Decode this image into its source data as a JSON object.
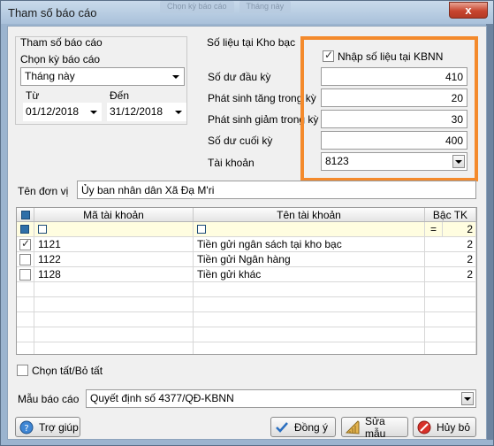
{
  "window": {
    "title": "Tham số báo cáo",
    "close_label": "x",
    "background_tabs": [
      "Chọn kỳ báo cáo",
      "Tháng này"
    ]
  },
  "report_params": {
    "group_title": "Tham số báo cáo",
    "period_label": "Chọn kỳ báo cáo",
    "period_value": "Tháng này",
    "from_label": "Từ",
    "to_label": "Đến",
    "from_date": "01/12/2018",
    "to_date": "31/12/2018"
  },
  "treasury": {
    "group_title": "Số liệu tại Kho bạc",
    "enter_checkbox_label": "Nhập số liệu tại KBNN",
    "enter_checked": true,
    "opening_balance_label": "Số dư đầu kỳ",
    "opening_balance": "410",
    "increase_label": "Phát sinh tăng trong kỳ",
    "increase": "20",
    "decrease_label": "Phát sinh giảm trong kỳ",
    "decrease": "30",
    "closing_balance_label": "Số dư cuối kỳ",
    "closing_balance": "400",
    "account_label": "Tài khoản",
    "account_value": "8123"
  },
  "unit": {
    "label": "Tên đơn vị",
    "value": "Ủy ban nhân dân Xã Đạ M'ri"
  },
  "grid": {
    "headers": [
      "Mã tài khoản",
      "Tên tài khoản",
      "Bậc TK"
    ],
    "filter_equals": "=",
    "filter_level": "2",
    "rows": [
      {
        "checked": true,
        "code": "1121",
        "name": "Tiền gửi ngân sách tại kho bạc",
        "level": "2"
      },
      {
        "checked": false,
        "code": "1122",
        "name": "Tiền gửi Ngân hàng",
        "level": "2"
      },
      {
        "checked": false,
        "code": "1128",
        "name": "Tiền gửi khác",
        "level": "2"
      }
    ]
  },
  "select_all_label": "Chọn tất/Bỏ tất",
  "template": {
    "label": "Mẫu báo cáo",
    "value": "Quyết định số 4377/QĐ-KBNN"
  },
  "buttons": {
    "help": "Trợ giúp",
    "agree": "Đồng ý",
    "edit_template": "Sửa mẫu",
    "cancel": "Hủy bỏ"
  },
  "colors": {
    "highlight": "#f48a2c",
    "title_bar": "#a9c1da",
    "close_button": "#c7452f"
  }
}
